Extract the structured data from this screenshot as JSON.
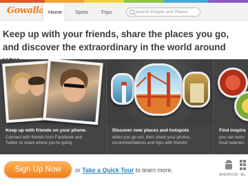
{
  "header": {
    "logo_text": "Gowalla",
    "nav": [
      {
        "label": "Home",
        "active": true
      },
      {
        "label": "Spots",
        "active": false
      },
      {
        "label": "Trips",
        "active": false
      }
    ],
    "search": {
      "placeholder": "Search People and Places"
    }
  },
  "headline": "Keep up with your friends, share the places you go, and discover the extraordinary in the world around you.",
  "features": [
    {
      "title": "Keep up with friends on your phone.",
      "description": "Connect with friends from Facebook and\nTwitter to share where you're going."
    },
    {
      "title": "Discover new places and hotspots",
      "description": "when you go out, then share your photos,\nrecommendations and trips with friends!"
    },
    {
      "title": "Find inspira",
      "description": "you can learn\nlocal eateries"
    }
  ],
  "cta": {
    "signup_label": "Sign Up Now",
    "or_text": "or ",
    "tour_link": "Take a Quick Tour",
    "suffix_text": " to learn more."
  },
  "platforms": [
    {
      "icon": "android-icon",
      "label": "ANDROID"
    },
    {
      "icon": "blackberry-icon",
      "label": "BL"
    }
  ],
  "colors": {
    "brand_orange": "#f07e17",
    "link_blue": "#2a7fc0",
    "band_bg": "#3b3b3b"
  }
}
